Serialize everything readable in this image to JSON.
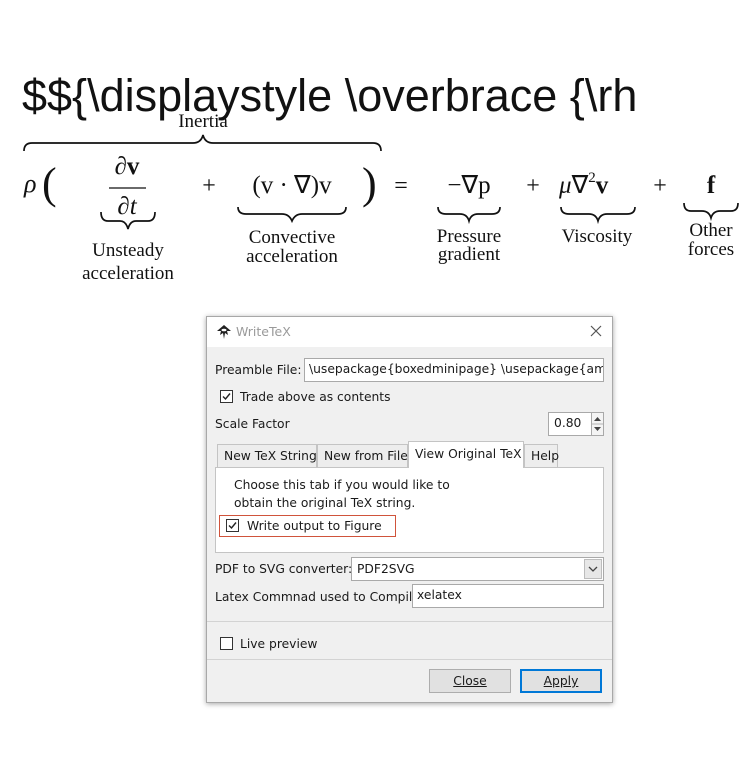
{
  "header": {
    "raw_tex": "$${\\displaystyle \\overbrace {\\rh"
  },
  "equation": {
    "rho": "ρ",
    "inertia_label": "Inertia",
    "dv": "∂v",
    "dt": "∂t",
    "plus": "+",
    "convective_term": "(v · ∇)v",
    "equals": "=",
    "pressure_term": "−∇p",
    "mu": "μ",
    "nabla": "∇",
    "squared": "2",
    "v": "v",
    "f": "f",
    "unsteady_label_1": "Unsteady",
    "unsteady_label_2": "acceleration",
    "convective_label_1": "Convective",
    "convective_label_2": "acceleration",
    "pressure_label_1": "Pressure",
    "pressure_label_2": "gradient",
    "viscosity_label": "Viscosity",
    "other_label_1": "Other",
    "other_label_2": "forces"
  },
  "dialog": {
    "title": "WriteTeX",
    "preamble_label": "Preamble File:",
    "preamble_value": "\\usepackage{boxedminipage} \\usepackage{amsfo",
    "trade_label": "Trade above as contents",
    "trade_checked": true,
    "scale_label": "Scale Factor",
    "scale_value": "0.80",
    "tabs": [
      "New TeX String",
      "New from File",
      "View Original TeX",
      "Help"
    ],
    "active_tab": "View Original TeX",
    "tab_text_line1": "Choose this tab if you would like to",
    "tab_text_line2": "obtain the original TeX string.",
    "write_output_label": "Write output to Figure",
    "write_output_checked": true,
    "converter_label": "PDF to SVG converter:",
    "converter_value": "PDF2SVG",
    "latex_label": "Latex Commnad used to Compile",
    "latex_value": "xelatex",
    "live_preview_label": "Live preview",
    "live_preview_checked": false,
    "close_button": "Close",
    "apply_button": "Apply",
    "highlight_color": "#d0533b",
    "default_button_color": "#0078d7"
  }
}
